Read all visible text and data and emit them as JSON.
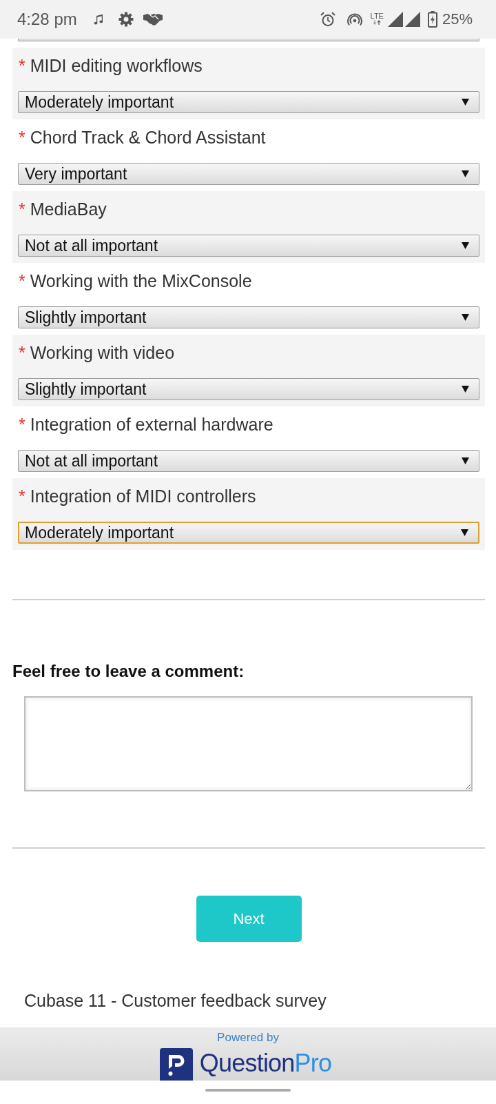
{
  "status_bar": {
    "time": "4:28 pm",
    "network": "LTE",
    "battery": "25%"
  },
  "questions": [
    {
      "required_mark": "*",
      "label": "MIDI editing workflows",
      "value": "Moderately important",
      "focused": false
    },
    {
      "required_mark": "*",
      "label": "Chord Track & Chord Assistant",
      "value": "Very important",
      "focused": false
    },
    {
      "required_mark": "*",
      "label": "MediaBay",
      "value": "Not at all important",
      "focused": false
    },
    {
      "required_mark": "*",
      "label": "Working with the MixConsole",
      "value": "Slightly important",
      "focused": false
    },
    {
      "required_mark": "*",
      "label": "Working with video",
      "value": "Slightly important",
      "focused": false
    },
    {
      "required_mark": "*",
      "label": "Integration of external hardware",
      "value": "Not at all important",
      "focused": false
    },
    {
      "required_mark": "*",
      "label": "Integration of MIDI controllers",
      "value": "Moderately important",
      "focused": true
    }
  ],
  "comment": {
    "label": "Feel free to leave a comment:"
  },
  "next_button": {
    "label": "Next"
  },
  "survey_title": "Cubase 11 - Customer feedback survey",
  "footer": {
    "powered_by": "Powered by",
    "brand": [
      {
        "text": "Question",
        "color": "#1f3280"
      },
      {
        "text": "Pro",
        "color": "#2b8fe5"
      }
    ]
  }
}
